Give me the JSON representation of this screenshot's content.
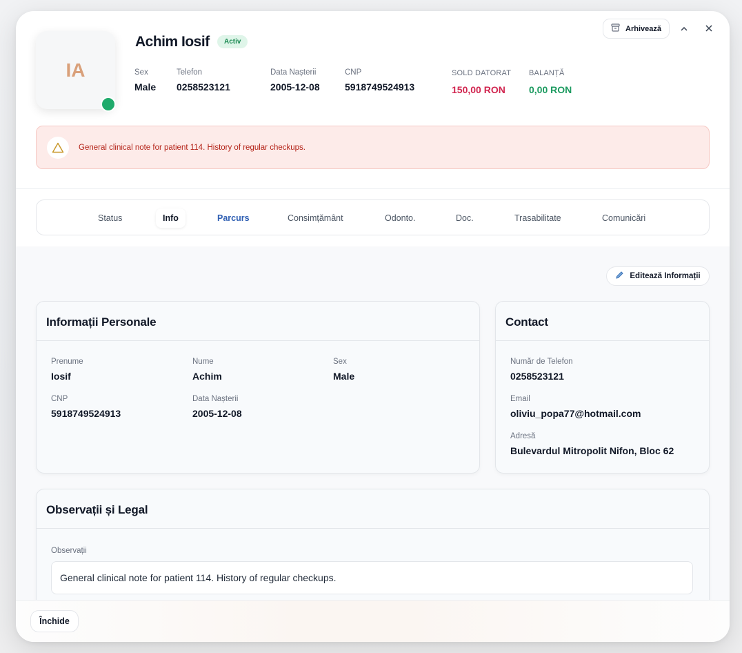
{
  "patient": {
    "initials": "IA",
    "name": "Achim Iosif",
    "status": "Activ",
    "fields": {
      "sex_label": "Sex",
      "sex_value": "Male",
      "phone_label": "Telefon",
      "phone_value": "0258523121",
      "dob_label": "Data Nașterii",
      "dob_value": "2005-12-08",
      "cnp_label": "CNP",
      "cnp_value": "5918749524913"
    },
    "sold_label": "SOLD DATORAT",
    "sold_value": "150,00 RON",
    "balance_label": "BALANȚĂ",
    "balance_value": "0,00 RON"
  },
  "actions": {
    "archive_label": "Arhivează"
  },
  "alert": {
    "text": "General clinical note for patient 114. History of regular checkups."
  },
  "tabs": [
    {
      "label": "Status"
    },
    {
      "label": "Info"
    },
    {
      "label": "Parcurs"
    },
    {
      "label": "Consimțământ"
    },
    {
      "label": "Odonto."
    },
    {
      "label": "Doc."
    },
    {
      "label": "Trasabilitate"
    },
    {
      "label": "Comunicări"
    }
  ],
  "edit_label": "Editează Informații",
  "personal": {
    "title": "Informații Personale",
    "first_name_label": "Prenume",
    "first_name": "Iosif",
    "last_name_label": "Nume",
    "last_name": "Achim",
    "sex_label": "Sex",
    "sex": "Male",
    "cnp_label": "CNP",
    "cnp": "5918749524913",
    "dob_label": "Data Nașterii",
    "dob": "2005-12-08"
  },
  "contact": {
    "title": "Contact",
    "phone_label": "Număr de Telefon",
    "phone": "0258523121",
    "email_label": "Email",
    "email": "oliviu_popa77@hotmail.com",
    "address_label": "Adresă",
    "address": "Bulevardul Mitropolit Nifon, Bloc 62"
  },
  "legal": {
    "title": "Observații și Legal",
    "obs_label": "Observații",
    "obs_text": "General clinical note for patient 114. History of regular checkups."
  },
  "footer": {
    "close_label": "Închide"
  },
  "colors": {
    "accent_blue": "#2f5fb3",
    "debt_red": "#d1254f",
    "balance_green": "#1b9a5f",
    "active_green": "#1faa6b"
  }
}
